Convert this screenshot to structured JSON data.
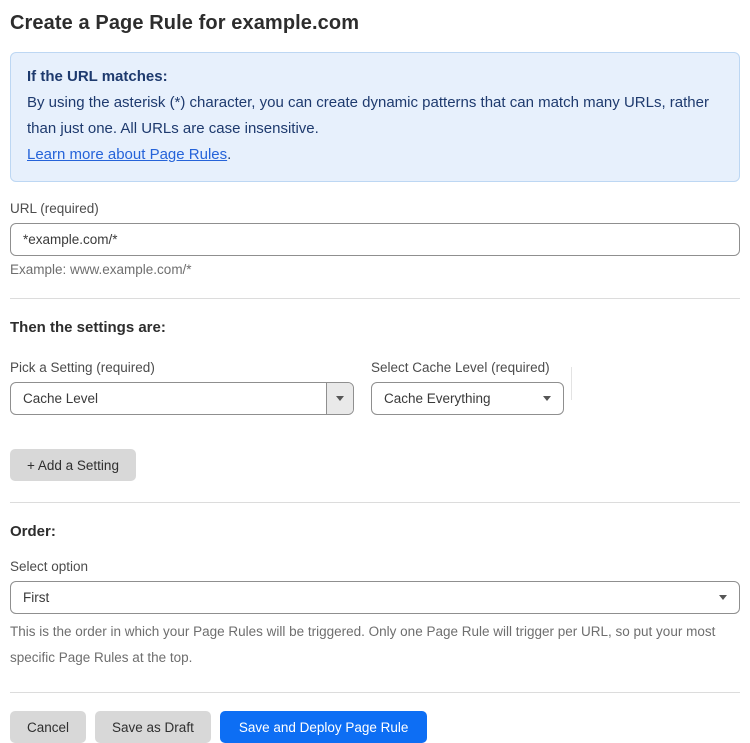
{
  "page": {
    "title": "Create a Page Rule for example.com"
  },
  "info_box": {
    "heading": "If the URL matches:",
    "body": "By using the asterisk (*) character, you can create dynamic patterns that can match many URLs, rather than just one. All URLs are case insensitive.",
    "link_label": "Learn more about Page Rules",
    "link_suffix": "."
  },
  "url_field": {
    "label": "URL (required)",
    "value": "*example.com/*",
    "hint": "Example: www.example.com/*"
  },
  "settings": {
    "heading": "Then the settings are:",
    "setting_label": "Pick a Setting (required)",
    "setting_value": "Cache Level",
    "cache_label": "Select Cache Level (required)",
    "cache_value": "Cache Everything",
    "add_button_label": "+ Add a Setting"
  },
  "order": {
    "heading": "Order:",
    "label": "Select option",
    "value": "First",
    "hint": "This is the order in which your Page Rules will be triggered. Only one Page Rule will trigger per URL, so put your most specific Page Rules at the top."
  },
  "actions": {
    "cancel_label": "Cancel",
    "save_draft_label": "Save as Draft",
    "save_deploy_label": "Save and Deploy Page Rule"
  },
  "colors": {
    "accent_blue": "#0d6ef4",
    "info_background": "#e7f0fc",
    "info_border": "#bdd7f3",
    "info_text": "#1e3a6e",
    "link_blue": "#2563d9",
    "button_gray": "#d8d8d8"
  }
}
